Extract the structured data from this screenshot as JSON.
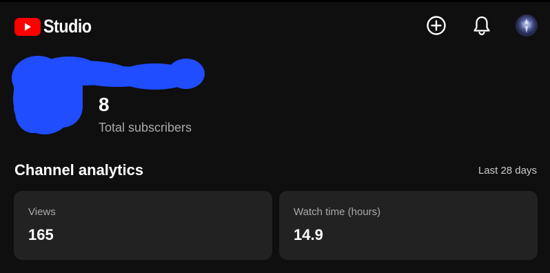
{
  "header": {
    "logo_text": "Studio",
    "brand_color": "#ff0000",
    "actions": {
      "create_icon": "add-circle-icon",
      "notifications_icon": "bell-icon",
      "avatar": "account-avatar"
    }
  },
  "channel": {
    "name_redacted": true,
    "subscriber_count": "8",
    "subscriber_label": "Total subscribers"
  },
  "analytics": {
    "title": "Channel analytics",
    "period": "Last 28 days",
    "cards": [
      {
        "label": "Views",
        "value": "165"
      },
      {
        "label": "Watch time (hours)",
        "value": "14.9"
      }
    ]
  },
  "colors": {
    "background": "#0f0f0f",
    "card_background": "#222222",
    "secondary_text": "#aaaaaa",
    "redaction_blue": "#1f4dff"
  }
}
